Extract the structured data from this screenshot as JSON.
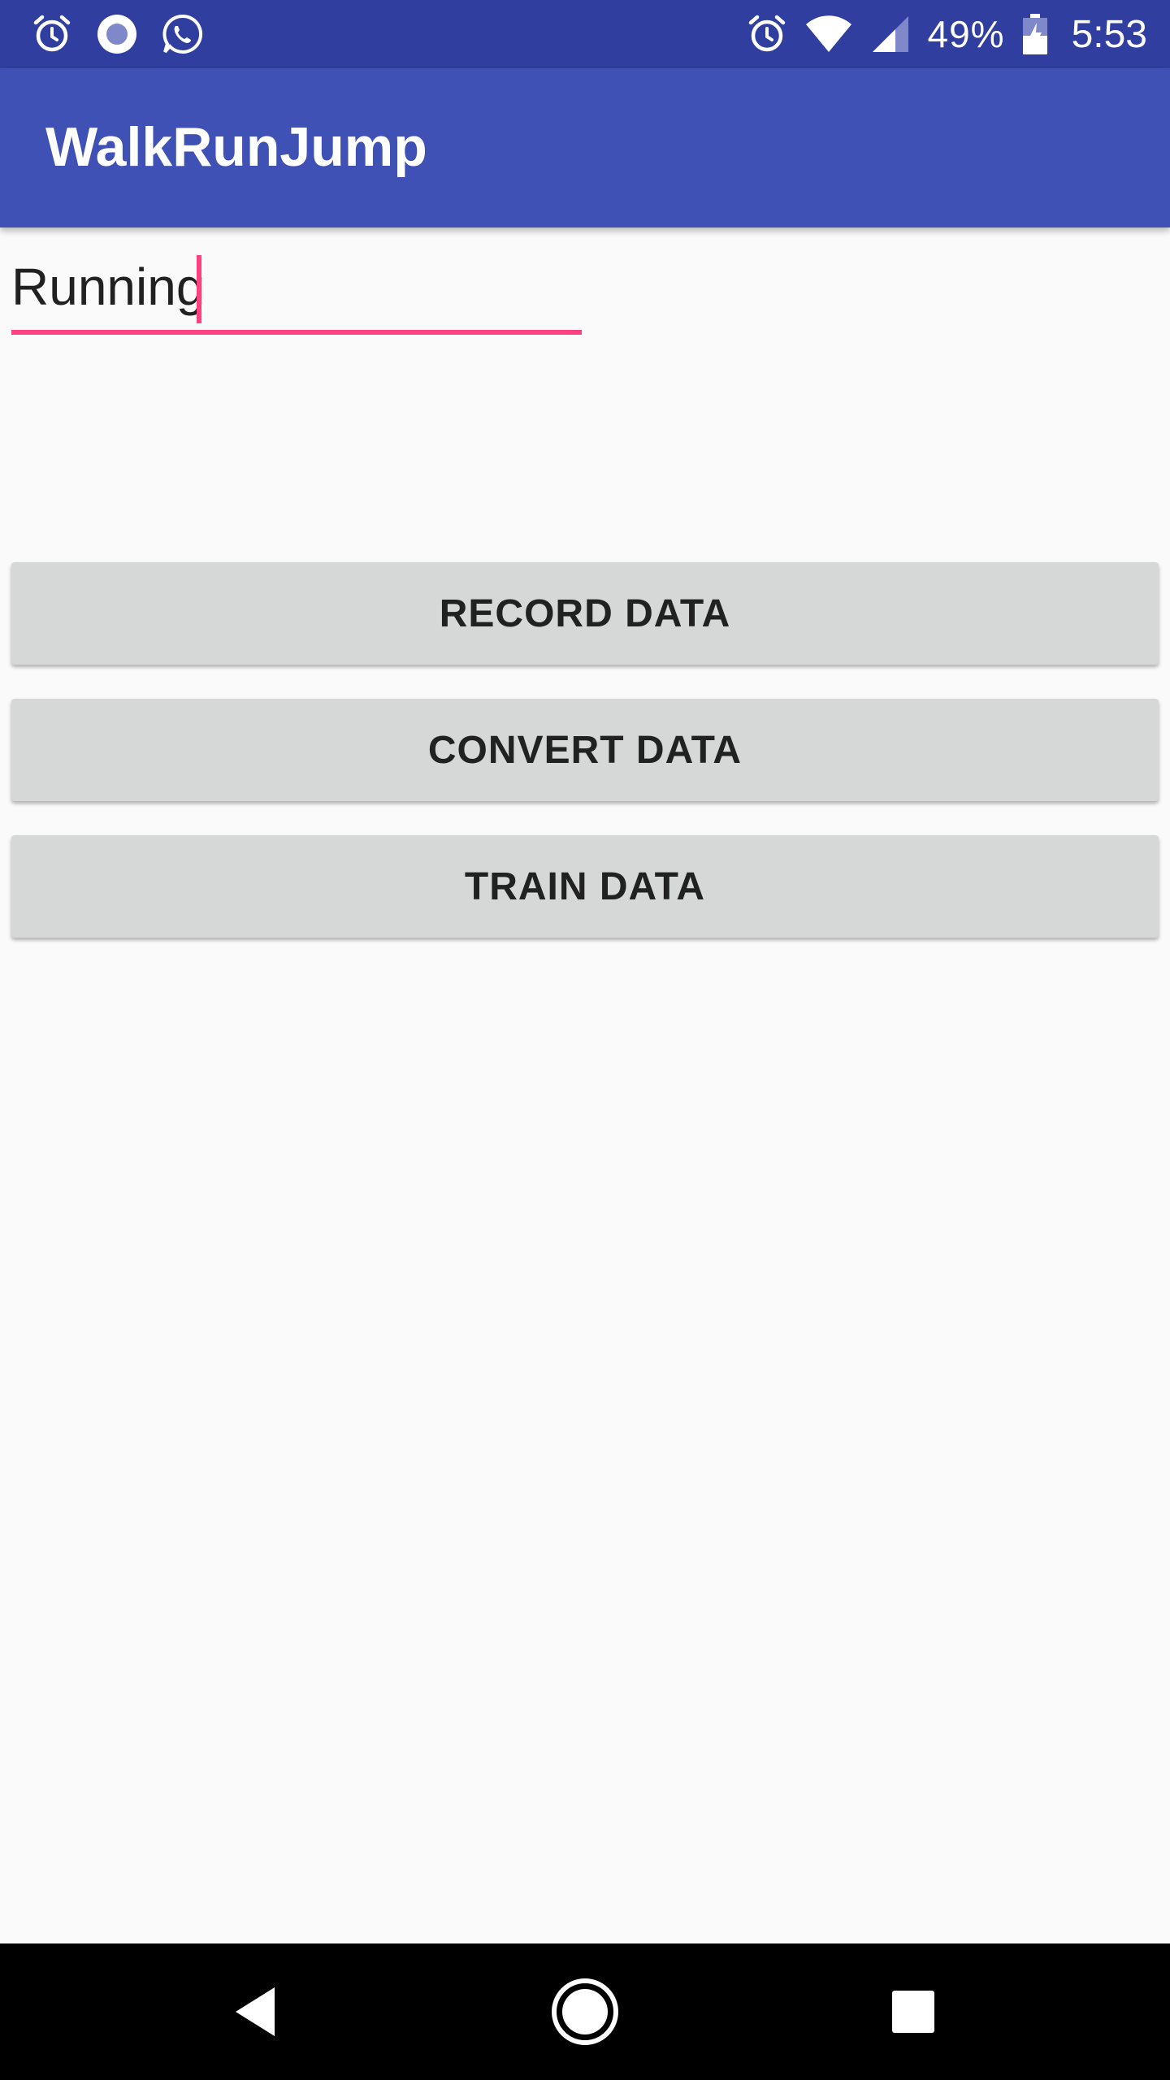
{
  "status_bar": {
    "left_icons": [
      "alarm-icon",
      "record-icon",
      "whatsapp-icon"
    ],
    "right_icons": [
      "alarm-icon",
      "wifi-icon",
      "cell-signal-icon",
      "battery-icon"
    ],
    "battery_percent": "49%",
    "time": "5:53"
  },
  "app_bar": {
    "title": "WalkRunJump"
  },
  "activity_input": {
    "value": "Running"
  },
  "buttons": {
    "record": "RECORD DATA",
    "convert": "CONVERT DATA",
    "train": "TRAIN DATA"
  },
  "nav_bar": {
    "icons": [
      "back-icon",
      "home-icon",
      "recents-icon"
    ]
  },
  "colors": {
    "status_bar": "#303f9f",
    "app_bar": "#3f51b5",
    "accent": "#ff4081",
    "button": "#d6d7d7",
    "background": "#fafafa"
  }
}
